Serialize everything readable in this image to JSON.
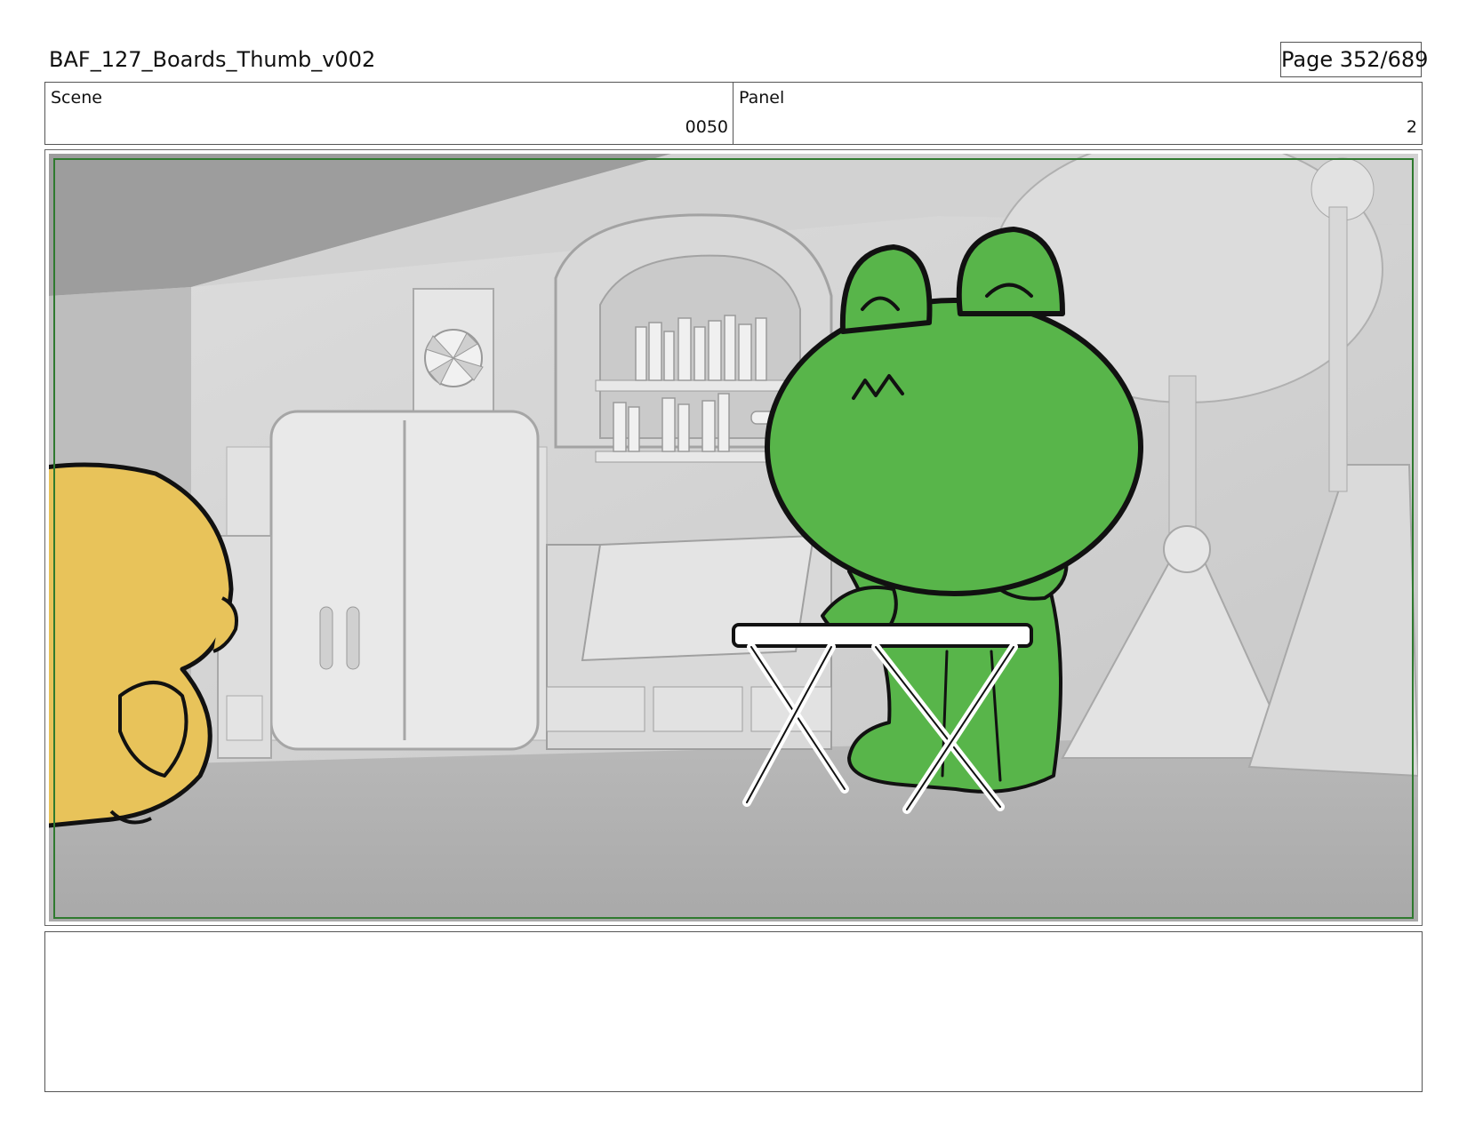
{
  "document": {
    "title": "BAF_127_Boards_Thumb_v002",
    "page_label": "Page 352/689"
  },
  "header": {
    "scene_label": "Scene",
    "scene_value": "0050",
    "panel_label": "Panel",
    "panel_value": "2"
  },
  "panel": {
    "frame_color": "#2f7a2f",
    "frog_color": "#58b54a",
    "chick_color": "#e8c35a",
    "background_tone": "#c9c9c9"
  },
  "notes": {
    "text": ""
  }
}
